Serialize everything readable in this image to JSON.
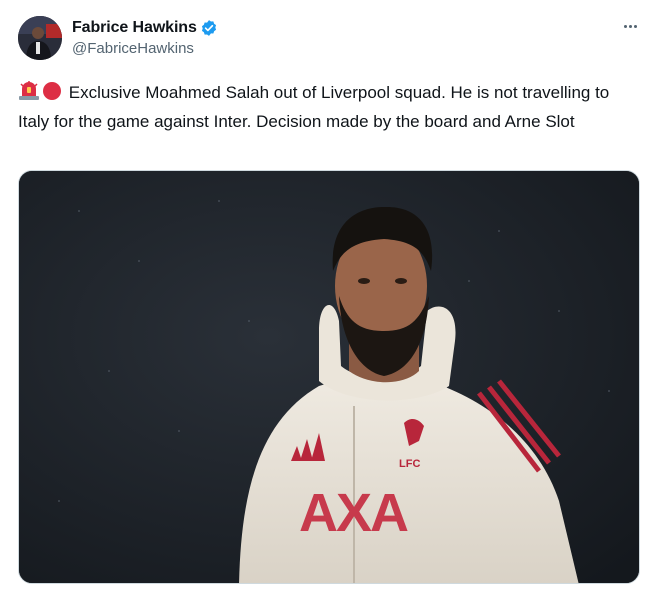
{
  "author": {
    "display_name": "Fabrice Hawkins",
    "handle": "@FabriceHawkins",
    "verified": true,
    "verified_color": "#1d9bf0"
  },
  "tweet": {
    "emojis": [
      "police-car-light-emoji",
      "red-circle-emoji"
    ],
    "text": "Exclusive Moahmed Salah out of Liverpool squad. He is not travelling to Italy for the game against Inter. Decision made by the board and Arne Slot"
  },
  "media": {
    "icon": "photo",
    "jersey_text": "AXA",
    "badge_text": "LFC"
  },
  "colors": {
    "text": "#0f1419",
    "secondary": "#536471",
    "accent": "#1d9bf0"
  }
}
